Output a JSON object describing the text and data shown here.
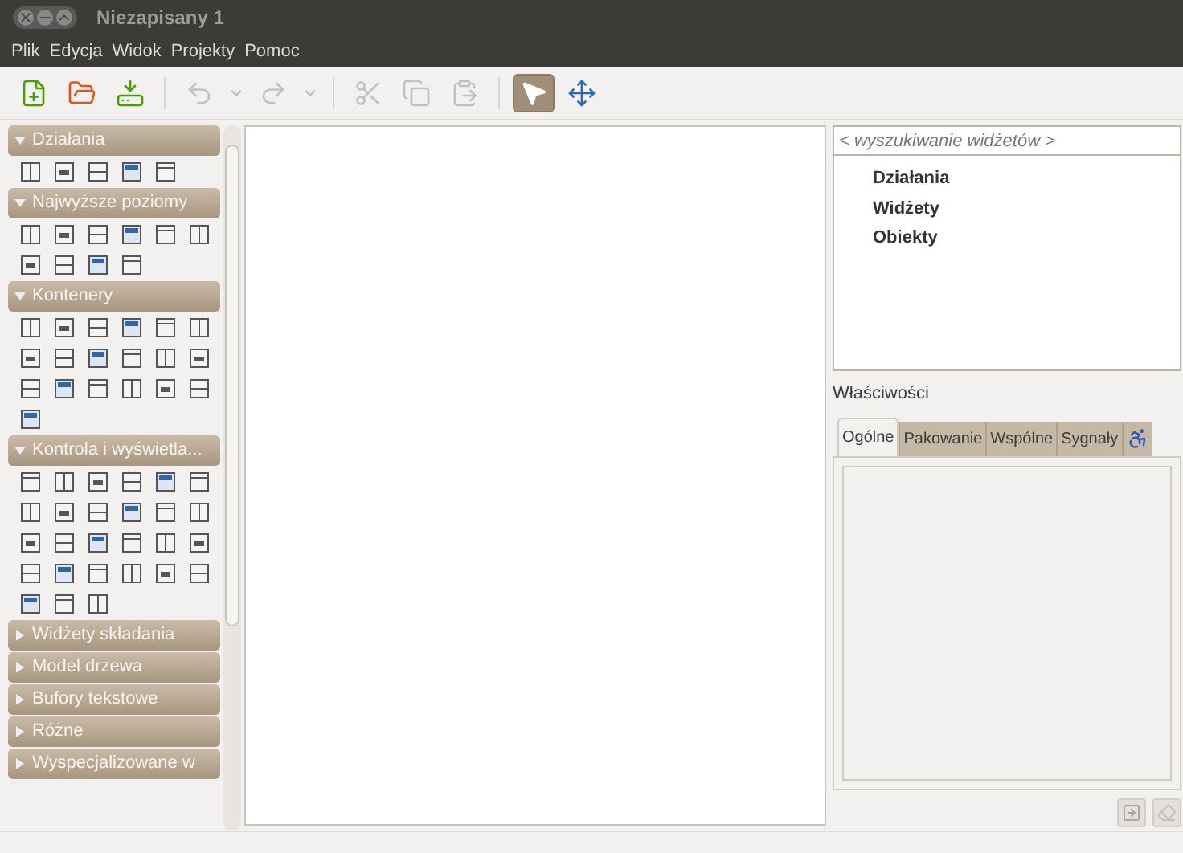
{
  "window": {
    "title": "Niezapisany 1"
  },
  "menu": [
    "Plik",
    "Edycja",
    "Widok",
    "Projekty",
    "Pomoc"
  ],
  "toolbar": [
    {
      "kind": "new",
      "disabled": false,
      "selected": false
    },
    {
      "kind": "open",
      "disabled": false,
      "selected": false
    },
    {
      "kind": "save",
      "disabled": false,
      "selected": false
    },
    {
      "kind": "undo",
      "disabled": true,
      "selected": false
    },
    {
      "kind": "dropdown",
      "disabled": true,
      "selected": false
    },
    {
      "kind": "redo",
      "disabled": true,
      "selected": false
    },
    {
      "kind": "dropdown",
      "disabled": true,
      "selected": false
    },
    {
      "kind": "cut",
      "disabled": true,
      "selected": false
    },
    {
      "kind": "copy",
      "disabled": true,
      "selected": false
    },
    {
      "kind": "paste",
      "disabled": true,
      "selected": false
    },
    {
      "kind": "select",
      "disabled": false,
      "selected": true
    },
    {
      "kind": "move",
      "disabled": false,
      "selected": false
    }
  ],
  "palette": [
    {
      "label": "Działania",
      "expanded": true
    },
    {
      "label": "Najwyższe poziomy",
      "expanded": true
    },
    {
      "label": "Kontenery",
      "expanded": true
    },
    {
      "label": "Kontrola i wyświetla...",
      "expanded": true
    },
    {
      "label": "Widżety składania",
      "expanded": false
    },
    {
      "label": "Model drzewa",
      "expanded": false
    },
    {
      "label": "Bufory tekstowe",
      "expanded": false
    },
    {
      "label": "Różne",
      "expanded": false
    },
    {
      "label": "Wyspecjalizowane w",
      "expanded": false
    }
  ],
  "inspector": {
    "search": {
      "placeholder": "< wyszukiwanie widżetów >"
    },
    "items": [
      "Działania",
      "Widżety",
      "Obiekty"
    ]
  },
  "properties": {
    "title": "Właściwości",
    "tabs": [
      {
        "kind": "text",
        "label": "Ogólne",
        "selected": true
      },
      {
        "kind": "text",
        "label": "Pakowanie",
        "selected": false
      },
      {
        "kind": "text",
        "label": "Wspólne",
        "selected": false
      },
      {
        "kind": "text",
        "label": "Sygnały",
        "selected": false
      },
      {
        "kind": "accessibility",
        "selected": false
      }
    ]
  }
}
